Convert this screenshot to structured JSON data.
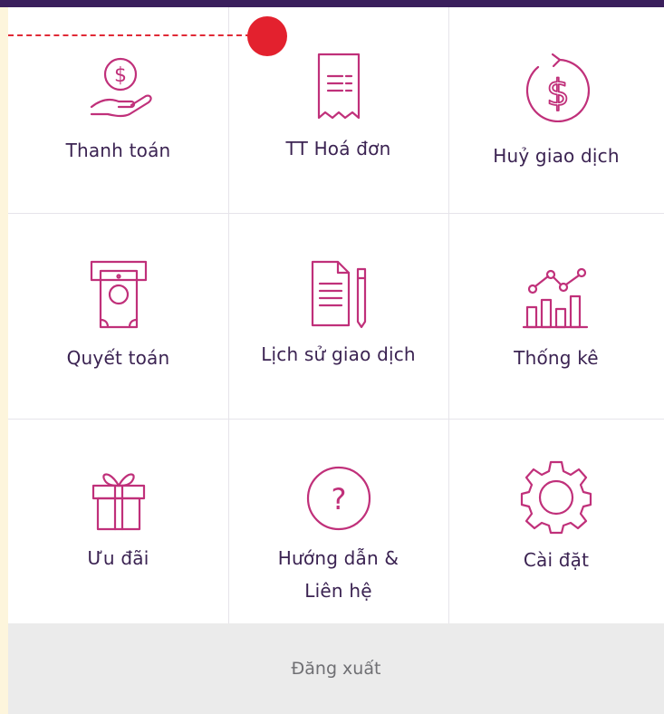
{
  "menu": {
    "items": [
      {
        "label": "Thanh toán",
        "icon": "hand-coin-icon"
      },
      {
        "label": "TT Hoá đơn",
        "icon": "receipt-icon"
      },
      {
        "label": "Huỷ giao dịch",
        "icon": "refund-dollar-icon"
      },
      {
        "label": "Quyết toán",
        "icon": "atm-cash-icon"
      },
      {
        "label": "Lịch sử giao dịch",
        "icon": "document-pen-icon"
      },
      {
        "label": "Thống kê",
        "icon": "chart-icon"
      },
      {
        "label": "Ưu đãi",
        "icon": "gift-icon"
      },
      {
        "label_line1": "Hướng dẫn &",
        "label_line2": "Liên hệ",
        "icon": "help-icon"
      },
      {
        "label": "Cài đặt",
        "icon": "gear-icon"
      }
    ]
  },
  "footer": {
    "logout_label": "Đăng xuất"
  },
  "colors": {
    "accent": "#c0307a",
    "text": "#3b2352",
    "header": "#3a1f5c",
    "marker": "#e3212e",
    "footer_bg": "#ebebeb"
  }
}
